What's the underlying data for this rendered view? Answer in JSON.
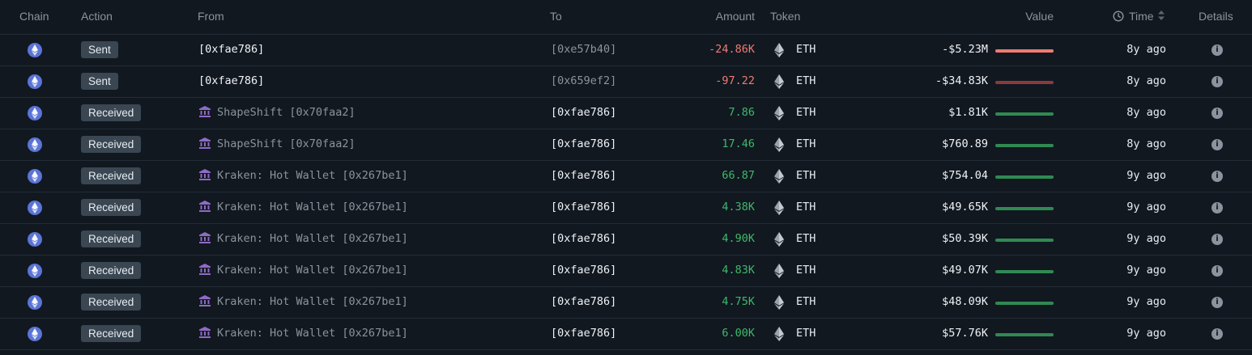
{
  "headers": {
    "chain": "Chain",
    "action": "Action",
    "from": "From",
    "to": "To",
    "amount": "Amount",
    "token": "Token",
    "value": "Value",
    "time": "Time",
    "details": "Details"
  },
  "colors": {
    "negative": "#f07b72",
    "positive": "#3fb96b",
    "bar_negative_strong": "#f07b72",
    "bar_negative_weak": "#8a3a3c",
    "bar_positive": "#2f8a52"
  },
  "rows": [
    {
      "action": "Sent",
      "from": "[0xfae786]",
      "from_entity": false,
      "to": "[0xe57b40]",
      "to_self": false,
      "amount": "-24.86K",
      "sign": "neg",
      "token": "ETH",
      "value": "-$5.23M",
      "bar": "neg-strong",
      "time": "8y ago"
    },
    {
      "action": "Sent",
      "from": "[0xfae786]",
      "from_entity": false,
      "to": "[0x659ef2]",
      "to_self": false,
      "amount": "-97.22",
      "sign": "neg",
      "token": "ETH",
      "value": "-$34.83K",
      "bar": "neg-weak",
      "time": "8y ago"
    },
    {
      "action": "Received",
      "from": "ShapeShift [0x70faa2]",
      "from_entity": true,
      "to": "[0xfae786]",
      "to_self": true,
      "amount": "7.86",
      "sign": "pos",
      "token": "ETH",
      "value": "$1.81K",
      "bar": "pos",
      "time": "8y ago"
    },
    {
      "action": "Received",
      "from": "ShapeShift [0x70faa2]",
      "from_entity": true,
      "to": "[0xfae786]",
      "to_self": true,
      "amount": "17.46",
      "sign": "pos",
      "token": "ETH",
      "value": "$760.89",
      "bar": "pos",
      "time": "8y ago"
    },
    {
      "action": "Received",
      "from": "Kraken: Hot Wallet [0x267be1]",
      "from_entity": true,
      "to": "[0xfae786]",
      "to_self": true,
      "amount": "66.87",
      "sign": "pos",
      "token": "ETH",
      "value": "$754.04",
      "bar": "pos",
      "time": "9y ago"
    },
    {
      "action": "Received",
      "from": "Kraken: Hot Wallet [0x267be1]",
      "from_entity": true,
      "to": "[0xfae786]",
      "to_self": true,
      "amount": "4.38K",
      "sign": "pos",
      "token": "ETH",
      "value": "$49.65K",
      "bar": "pos",
      "time": "9y ago"
    },
    {
      "action": "Received",
      "from": "Kraken: Hot Wallet [0x267be1]",
      "from_entity": true,
      "to": "[0xfae786]",
      "to_self": true,
      "amount": "4.90K",
      "sign": "pos",
      "token": "ETH",
      "value": "$50.39K",
      "bar": "pos",
      "time": "9y ago"
    },
    {
      "action": "Received",
      "from": "Kraken: Hot Wallet [0x267be1]",
      "from_entity": true,
      "to": "[0xfae786]",
      "to_self": true,
      "amount": "4.83K",
      "sign": "pos",
      "token": "ETH",
      "value": "$49.07K",
      "bar": "pos",
      "time": "9y ago"
    },
    {
      "action": "Received",
      "from": "Kraken: Hot Wallet [0x267be1]",
      "from_entity": true,
      "to": "[0xfae786]",
      "to_self": true,
      "amount": "4.75K",
      "sign": "pos",
      "token": "ETH",
      "value": "$48.09K",
      "bar": "pos",
      "time": "9y ago"
    },
    {
      "action": "Received",
      "from": "Kraken: Hot Wallet [0x267be1]",
      "from_entity": true,
      "to": "[0xfae786]",
      "to_self": true,
      "amount": "6.00K",
      "sign": "pos",
      "token": "ETH",
      "value": "$57.76K",
      "bar": "pos",
      "time": "9y ago"
    }
  ]
}
